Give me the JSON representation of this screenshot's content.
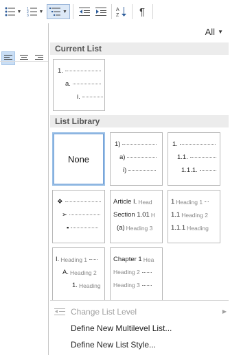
{
  "ribbon": {
    "buttons": [
      {
        "name": "bullets-button",
        "icon": "bullets-icon"
      },
      {
        "name": "numbering-button",
        "icon": "numbering-icon"
      },
      {
        "name": "multilevel-list-button",
        "icon": "multilevel-list-icon",
        "active": true
      },
      {
        "name": "decrease-indent-button",
        "icon": "decrease-indent-icon"
      },
      {
        "name": "increase-indent-button",
        "icon": "increase-indent-icon"
      },
      {
        "name": "sort-button",
        "icon": "sort-az-icon"
      },
      {
        "name": "show-formatting-button",
        "icon": "pilcrow-icon",
        "glyph": "¶"
      }
    ]
  },
  "panel": {
    "filter": {
      "label": "All"
    },
    "current_list": {
      "title": "Current List",
      "rows": [
        "1.",
        "a.",
        "i."
      ]
    },
    "list_library": {
      "title": "List Library",
      "tiles": [
        {
          "name": "none",
          "label": "None"
        },
        {
          "name": "paren",
          "rows": [
            "1)",
            "a)",
            "i)"
          ]
        },
        {
          "name": "decimal",
          "rows": [
            "1.",
            "1.1.",
            "1.1.1."
          ]
        },
        {
          "name": "bullets",
          "rows": [
            "❖",
            "➢",
            "▪"
          ]
        },
        {
          "name": "article-section",
          "rows": [
            {
              "t": "Article I.",
              "h": "Head"
            },
            {
              "t": "Section 1.01",
              "h": "H"
            },
            {
              "t": "(a)",
              "h": "Heading 3"
            }
          ]
        },
        {
          "name": "heading-decimal",
          "rows": [
            {
              "t": "1",
              "h": "Heading 1"
            },
            {
              "t": "1.1",
              "h": "Heading 2"
            },
            {
              "t": "1.1.1",
              "h": "Heading"
            }
          ]
        },
        {
          "name": "heading-roman",
          "rows": [
            {
              "t": "I.",
              "h": "Heading 1"
            },
            {
              "t": "A.",
              "h": "Heading 2"
            },
            {
              "t": "1.",
              "h": "Heading"
            }
          ]
        },
        {
          "name": "chapter",
          "rows": [
            {
              "t": "Chapter 1",
              "h": "Hea"
            },
            {
              "t": "",
              "h": "Heading 2"
            },
            {
              "t": "",
              "h": "Heading 3"
            }
          ]
        }
      ]
    },
    "menu": [
      {
        "label": "Change List Level",
        "disabled": true,
        "submenu": true
      },
      {
        "label": "Define New Multilevel List...",
        "disabled": false
      },
      {
        "label": "Define New List Style...",
        "disabled": false
      }
    ]
  }
}
